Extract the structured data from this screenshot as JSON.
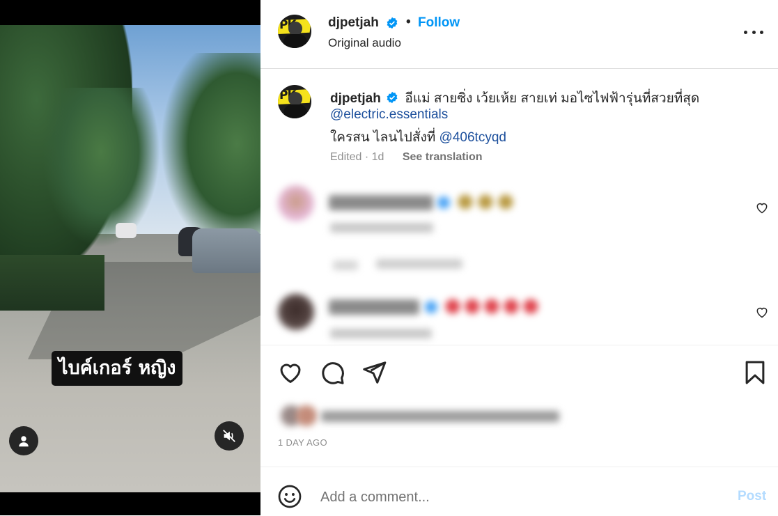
{
  "video": {
    "overlay_text": "ไบค์เกอร์ หญิง",
    "user_button_icon": "user-icon",
    "mute_button_icon": "muted-speaker-icon"
  },
  "header": {
    "username": "djpetjah",
    "verified_icon": "verified-badge-icon",
    "separator": "•",
    "follow_label": "Follow",
    "audio_label": "Original audio",
    "more_icon": "more-options-icon"
  },
  "avatar_text": "PK",
  "caption": {
    "username": "djpetjah",
    "text": "อีแม่ สายซิ่ง เว้ยเห้ย สายเท่ มอไซไฟฟ้ารุ่นที่สวยที่สุด",
    "mention": "@electric.essentials",
    "line3_text": "ใครสน ไลนไปสั่งที่",
    "line3_link": "@406tcyqd",
    "meta": "Edited · 1d",
    "see_translation": "See translation"
  },
  "comments": {
    "blurred": true,
    "like_icon": "heart-outline-icon"
  },
  "actions": {
    "like_icon": "heart-icon",
    "comment_icon": "comment-bubble-icon",
    "share_icon": "paper-plane-icon",
    "save_icon": "bookmark-icon"
  },
  "post_date": "1 DAY AGO",
  "composer": {
    "emoji_icon": "smiley-icon",
    "placeholder": "Add a comment...",
    "post_label": "Post"
  },
  "colors": {
    "accent": "#0095f6",
    "post_disabled": "#b3dbff",
    "link": "#00376b"
  }
}
